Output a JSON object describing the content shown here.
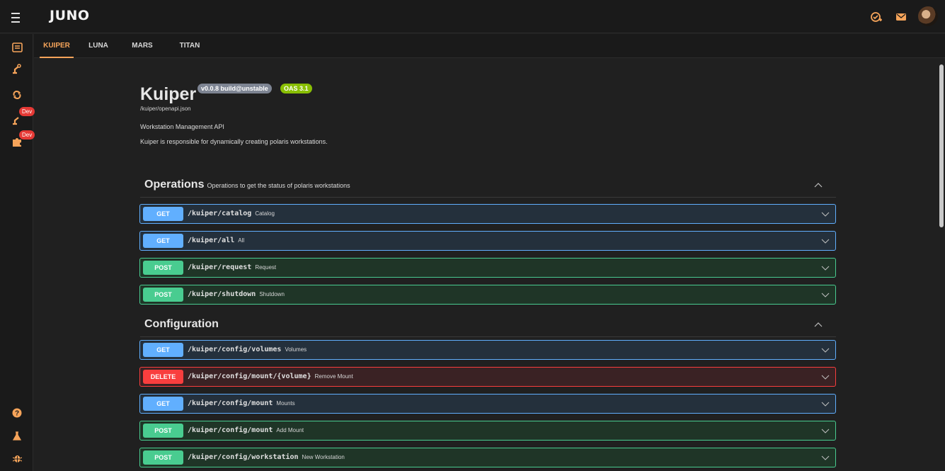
{
  "app": {
    "logo": "JUNO"
  },
  "tabs": [
    {
      "label": "KUIPER",
      "active": true
    },
    {
      "label": "LUNA",
      "active": false
    },
    {
      "label": "MARS",
      "active": false
    },
    {
      "label": "TITAN",
      "active": false
    }
  ],
  "sidebar": {
    "dev_badge_1": "Dev",
    "dev_badge_2": "Dev"
  },
  "api": {
    "title": "Kuiper",
    "version": "v0.0.8 build@unstable",
    "oas": "OAS 3.1",
    "spec_url": "/kuiper/openapi.json",
    "summary": "Workstation Management API",
    "description": "Kuiper is responsible for dynamically creating polaris workstations."
  },
  "sections": [
    {
      "name": "Operations",
      "description": "Operations to get the status of polaris workstations",
      "operations": [
        {
          "method": "GET",
          "path": "/kuiper/catalog",
          "summary": "Catalog"
        },
        {
          "method": "GET",
          "path": "/kuiper/all",
          "summary": "All"
        },
        {
          "method": "POST",
          "path": "/kuiper/request",
          "summary": "Request"
        },
        {
          "method": "POST",
          "path": "/kuiper/shutdown",
          "summary": "Shutdown"
        }
      ]
    },
    {
      "name": "Configuration",
      "description": "",
      "operations": [
        {
          "method": "GET",
          "path": "/kuiper/config/volumes",
          "summary": "Volumes"
        },
        {
          "method": "DELETE",
          "path": "/kuiper/config/mount/{volume}",
          "summary": "Remove Mount"
        },
        {
          "method": "GET",
          "path": "/kuiper/config/mount",
          "summary": "Mounts"
        },
        {
          "method": "POST",
          "path": "/kuiper/config/mount",
          "summary": "Add Mount"
        },
        {
          "method": "POST",
          "path": "/kuiper/config/workstation",
          "summary": "New Workstation"
        }
      ]
    }
  ],
  "colors": {
    "accent": "#f6a45a",
    "get": "#61affe",
    "post": "#49cc90",
    "delete": "#f93e3e",
    "dev_badge": "#e53935"
  },
  "icons": {
    "menu": "menu-icon",
    "tasks": "task-check-icon",
    "mail": "mail-icon",
    "sidebar": [
      "list-icon",
      "robot-arm-icon",
      "refresh-icon",
      "robot-arm-dev-icon",
      "puzzle-dev-icon",
      "help-icon",
      "flask-icon",
      "bug-icon"
    ]
  }
}
